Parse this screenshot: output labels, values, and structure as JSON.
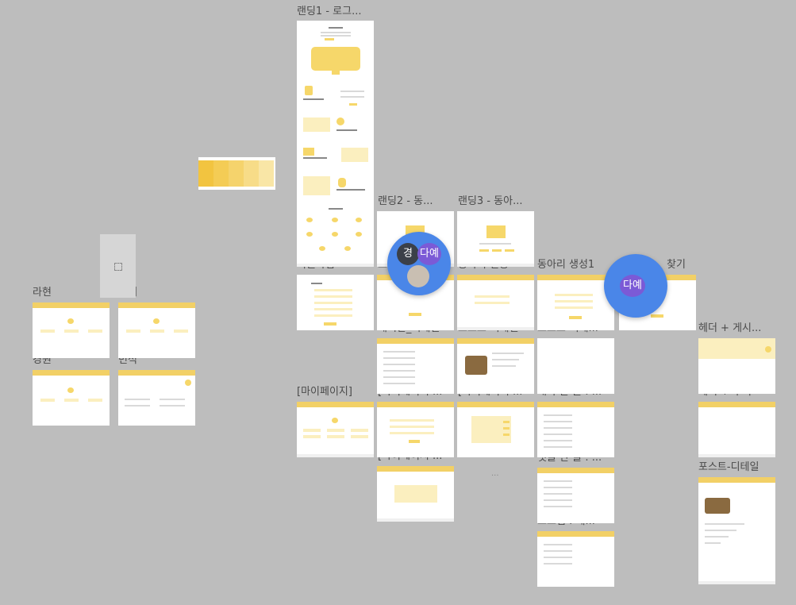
{
  "frames": {
    "landing1": "랜딩1 - 로그...",
    "landing2": "랜딩2 - 동...",
    "landing3": "랜딩3 - 동아...",
    "signup": "회원가입",
    "login": "로",
    "club_auth": "동아리 인증",
    "club_create": "동아리 생성1",
    "find_suffix": "찾기",
    "board_detail": "게시판_디테일",
    "post_detail_a": "포스트-디테일",
    "post_detail_b": "포스트-디테...",
    "header_board": "헤더 + 게시...",
    "mypage": "[마이페이지]",
    "mypage_2": "[마이페이지 ...",
    "mypage_3": "[마이페이지 ...",
    "my_posts": "내가 쓴 글 : ...",
    "header_footer": "헤더 + 푸터",
    "mypage_4": "[마이페이지 ...",
    "my_comments": "댓글 단 글 : ...",
    "post_detail_c": "포스트-디테일",
    "scrap": "스크랩 : 게...",
    "rahyeon": "라현",
    "daye": "다예",
    "gyeongwon": "경원",
    "minseok": "민석"
  },
  "collaborators": {
    "a_initial": "경",
    "b_initial": "다예",
    "cursor_label": "다예"
  },
  "swatch_colors": [
    "#f2c440",
    "#f4cc55",
    "#f5d36c",
    "#f7dc88",
    "#f9e6a6"
  ],
  "accent": "#f2d066",
  "cursor_color": "#4a86e8",
  "icons": {
    "expand": "expand-icon",
    "more": "ellipsis-icon"
  }
}
